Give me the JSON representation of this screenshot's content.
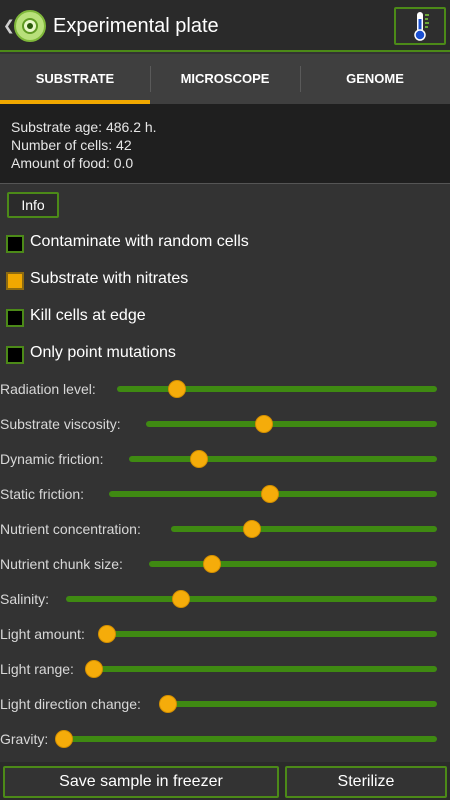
{
  "header": {
    "back_glyph": "❮",
    "title": "Experimental plate",
    "thermometer_icon": "thermometer-icon"
  },
  "tabs": [
    {
      "label": "SUBSTRATE",
      "selected": true
    },
    {
      "label": "MICROSCOPE",
      "selected": false
    },
    {
      "label": "GENOME",
      "selected": false
    }
  ],
  "stats": {
    "age": "Substrate age: 486.2 h.",
    "cells": "Number of cells: 42",
    "food": "Amount of food: 0.0"
  },
  "info_label": "Info",
  "checkboxes": [
    {
      "label": "Contaminate with random cells",
      "checked": false
    },
    {
      "label": "Substrate with nitrates",
      "checked": true
    },
    {
      "label": "Kill cells at edge",
      "checked": false
    },
    {
      "label": "Only point mutations",
      "checked": false
    }
  ],
  "sliders": [
    {
      "label": "Radiation level:",
      "value": 0.17
    },
    {
      "label": "Substrate viscosity:",
      "value": 0.4
    },
    {
      "label": "Dynamic friction:",
      "value": 0.21
    },
    {
      "label": "Static friction:",
      "value": 0.49
    },
    {
      "label": "Nutrient concentration:",
      "value": 0.29
    },
    {
      "label": "Nutrient chunk size:",
      "value": 0.2
    },
    {
      "label": "Salinity:",
      "value": 0.3
    },
    {
      "label": "Light amount:",
      "value": 0.0
    },
    {
      "label": "Light range:",
      "value": 0.0
    },
    {
      "label": "Light direction change:",
      "value": 0.0
    },
    {
      "label": "Gravity:",
      "value": 0.0
    }
  ],
  "buttons": {
    "save": "Save sample in freezer",
    "sterilize": "Sterilize"
  },
  "colors": {
    "accent": "#f0a800",
    "green": "#4c8a18"
  }
}
